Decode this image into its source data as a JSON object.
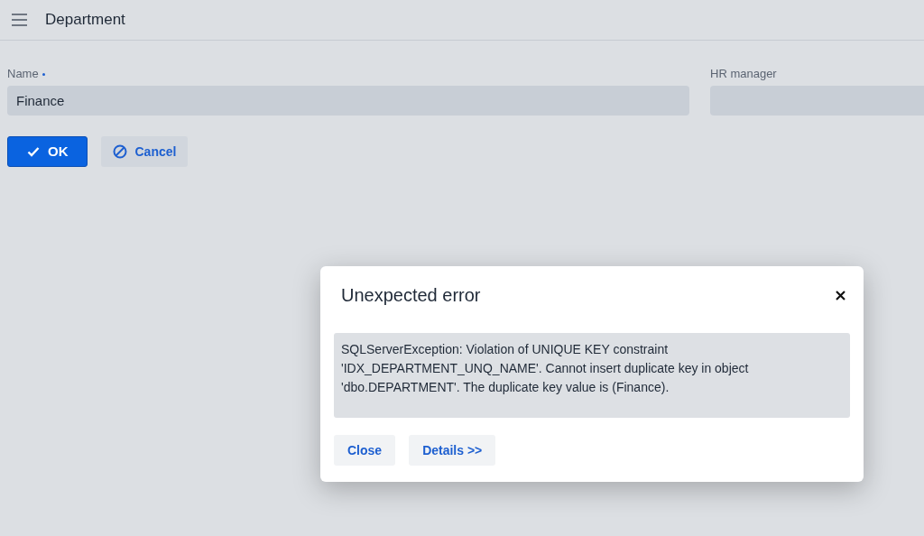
{
  "header": {
    "title": "Department"
  },
  "fields": [
    {
      "label": "Name",
      "required": true,
      "value": "Finance"
    },
    {
      "label": "HR manager",
      "required": false
    }
  ],
  "buttons": [
    {
      "label": "OK",
      "kind": "primary"
    },
    {
      "label": "Cancel",
      "kind": "secondary"
    }
  ],
  "dialog": {
    "title": "Unexpected error",
    "message": "SQLServerException: Violation of UNIQUE KEY constraint 'IDX_DEPARTMENT_UNQ_NAME'. Cannot insert duplicate key in object 'dbo.DEPARTMENT'. The duplicate key value is (Finance).",
    "buttons": [
      "Close",
      "Details >>"
    ]
  }
}
